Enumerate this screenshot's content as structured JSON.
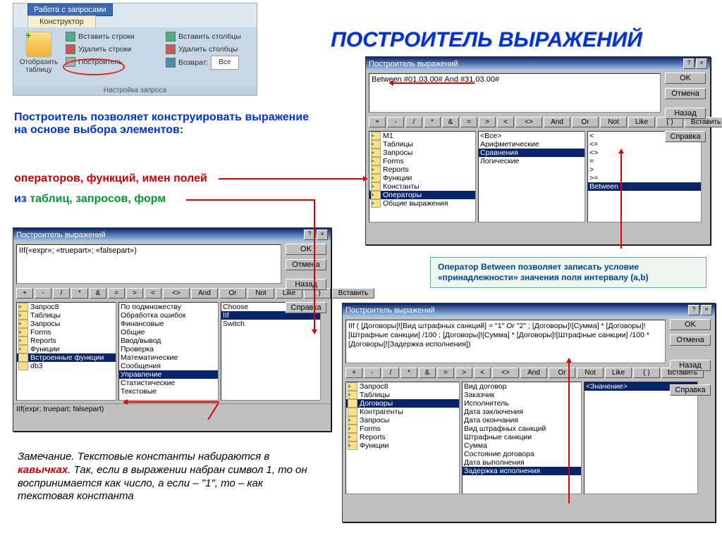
{
  "page_title": "ПОСТРОИТЕЛЬ  ВЫРАЖЕНИЙ",
  "ribbon": {
    "tab1": "Работа с запросами",
    "tab2": "Конструктор",
    "big_button": "Отобразить таблицу",
    "col1": [
      "Вставить строки",
      "Удалить строки",
      "Построитель"
    ],
    "col2": [
      "Вставить столбцы",
      "Удалить столбцы",
      "Возврат:"
    ],
    "return_value": "Все",
    "footer": "Настройка запроса"
  },
  "texts": {
    "intro1": "Построитель позволяет конструировать выражение на основе выбора элементов:",
    "intro2": "операторов, функций, имен полей",
    "intro3a": "из ",
    "intro3b": "таблиц, запросов, форм",
    "note": "Замечание. Текстовые константы набираются в ",
    "note_kw": "кавычках",
    "note2": ". Так, если в выражении набран символ 1, то он воспринимается как число, а если – \"1\", то – как текстовая константа"
  },
  "tip": "Оператор Between позволяет записать условие «принадлежности» значения поля интервалу (a,b)",
  "ops": [
    "+",
    "-",
    "/",
    "*",
    "&",
    "=",
    ">",
    "<",
    "<>",
    "And",
    "Or",
    "Not",
    "Like",
    "( )"
  ],
  "insert_label": "Вставить",
  "side_buttons": [
    "OK",
    "Отмена",
    "Назад",
    "Справка"
  ],
  "dlg_title": "Построитель выражений",
  "dlg1": {
    "expr": "Between #01.03.00# And #31.03.00#",
    "pane1": [
      "М1",
      "Таблицы",
      "Запросы",
      "Forms",
      "Reports",
      "Функции",
      "Константы",
      "Операторы",
      "Общие выражения"
    ],
    "pane1_sel": 7,
    "pane2": [
      "<Все>",
      "Арифметические",
      "Сравнения",
      "Логические"
    ],
    "pane2_sel": 2,
    "pane3": [
      "<",
      "<=",
      "<>",
      "=",
      ">",
      ">=",
      "Between"
    ],
    "pane3_sel": 6
  },
  "dlg2": {
    "expr": "IIf(«expr»; «truepart»; «falsepart»)",
    "pane1": [
      "Запрос8",
      "Таблицы",
      "Запросы",
      "Forms",
      "Reports",
      "Функции",
      "  Встроенные функции",
      "  db3"
    ],
    "pane1_sel": 6,
    "pane2": [
      "По подмножеству",
      "Обработка ошибок",
      "Финансовые",
      "Общие",
      "Ввод/вывод",
      "Проверка",
      "Математические",
      "Сообщения",
      "Управление",
      "Статистические",
      "Текстовые"
    ],
    "pane2_sel": 8,
    "pane3": [
      "Choose",
      "IIf",
      "Switch"
    ],
    "pane3_sel": 1,
    "status": "IIf(expr; truepart; falsepart)"
  },
  "dlg3": {
    "expr": "IIf ( [Договоры]![Вид штрафных санкций] = \"1\" Or \"2\" ;  [Договоры]![Сумма] * [Договоры]![Штрафные санкции] /100 ;  [Договоры]![Сумма] * [Договоры]![Штрафные санкции] /100 * [Договоры]![Задержка исполнения])",
    "pane1": [
      "Запрос8",
      "Таблицы",
      "  Договоры",
      "  Контрагенты",
      "Запросы",
      "Forms",
      "Reports",
      "Функции"
    ],
    "pane1_sel": 2,
    "pane2": [
      "Вид договор",
      "Заказчик",
      "Исполнитель",
      "Дата заключения",
      "Дата окончания",
      "Вид штрафных санкций",
      "Штрафные санкции",
      "Сумма",
      "Состояние договора",
      "Дата выполнения",
      "Задержка исполнения"
    ],
    "pane2_sel": 10,
    "pane3": [
      "<Значение>"
    ],
    "pane3_sel": 0
  }
}
